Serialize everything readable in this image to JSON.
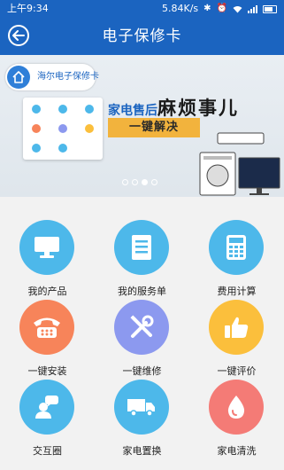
{
  "status_bar": {
    "time": "上午9:34",
    "speed": "5.84K/s"
  },
  "header": {
    "title": "电子保修卡"
  },
  "banner": {
    "badge_label": "海尔电子保修卡",
    "headline_part1": "家电售后",
    "headline_part2": "麻烦事儿",
    "subheadline": "一键解决",
    "active_slide": 3,
    "slide_count": 4
  },
  "grid": {
    "items": [
      {
        "label": "我的产品",
        "icon": "monitor-icon",
        "color": "#4db8ea"
      },
      {
        "label": "我的服务单",
        "icon": "document-icon",
        "color": "#4db8ea"
      },
      {
        "label": "费用计算",
        "icon": "calculator-icon",
        "color": "#4db8ea"
      },
      {
        "label": "一键安装",
        "icon": "telephone-icon",
        "color": "#f7845a"
      },
      {
        "label": "一键维修",
        "icon": "tools-icon",
        "color": "#8c99ef"
      },
      {
        "label": "一键评价",
        "icon": "thumbs-up-icon",
        "color": "#fbbf3c"
      },
      {
        "label": "交互圈",
        "icon": "chat-user-icon",
        "color": "#4db8ea"
      },
      {
        "label": "家电置换",
        "icon": "truck-icon",
        "color": "#4db8ea"
      },
      {
        "label": "家电清洗",
        "icon": "water-drop-icon",
        "color": "#f47b76"
      }
    ]
  }
}
